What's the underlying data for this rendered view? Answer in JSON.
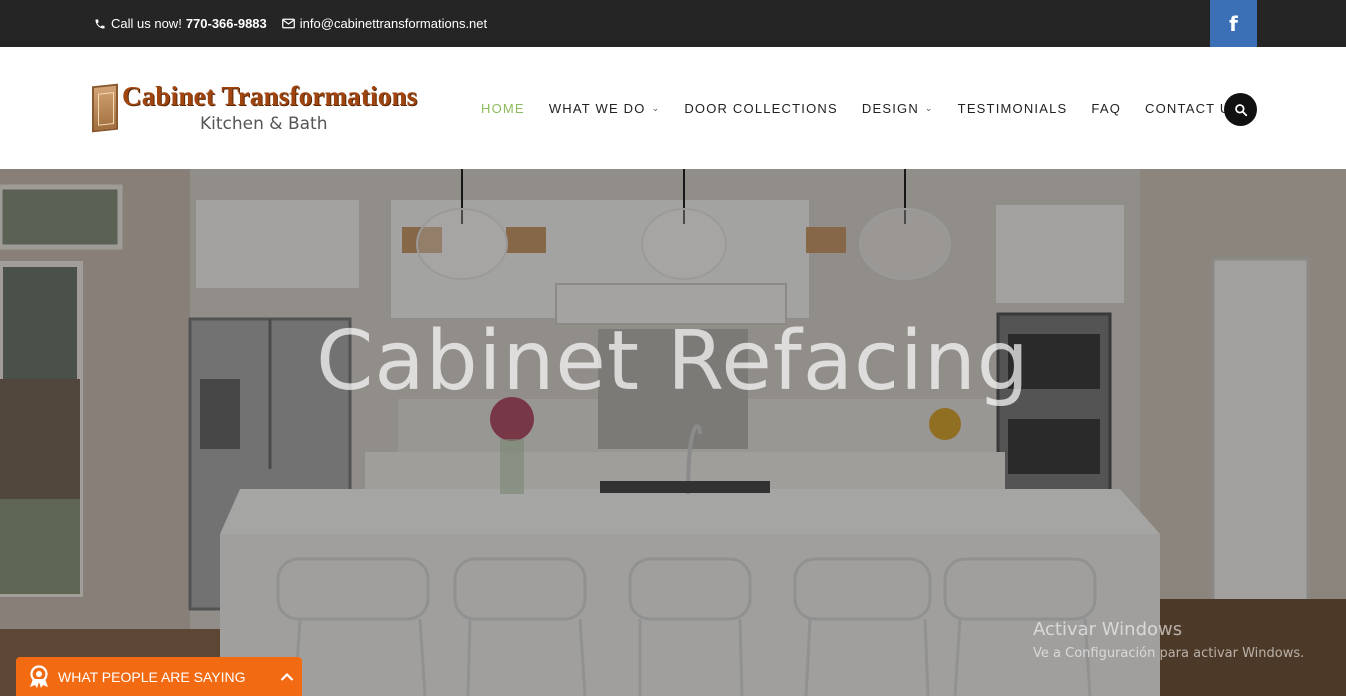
{
  "topbar": {
    "call_label": "Call us now!",
    "phone": "770-366-9883",
    "email": "info@cabinettransformations.net",
    "phone_icon": "phone-icon",
    "email_icon": "envelope-icon",
    "facebook_icon": "facebook-icon",
    "facebook_color": "#3b6fb6"
  },
  "logo": {
    "title": "Cabinet Transformations",
    "subtitle": "Kitchen & Bath"
  },
  "nav": {
    "items": [
      {
        "label": "HOME",
        "active": true
      },
      {
        "label": "WHAT WE DO",
        "dropdown": true
      },
      {
        "label": "DOOR COLLECTIONS"
      },
      {
        "label": "DESIGN",
        "dropdown": true
      },
      {
        "label": "TESTIMONIALS"
      },
      {
        "label": "FAQ"
      },
      {
        "label": "CONTACT US"
      }
    ],
    "chevron": "⌄",
    "search_icon": "search-icon",
    "active_color": "#8dbb5d"
  },
  "hero": {
    "title": "Cabinet Refacing"
  },
  "watermark": {
    "line1": "Activar Windows",
    "line2": "Ve a Configuración para activar Windows."
  },
  "reviews": {
    "label": "WHAT PEOPLE ARE SAYING",
    "badge_icon": "award-icon",
    "toggle_icon": "chevron-up-icon",
    "color": "#f26b13"
  }
}
